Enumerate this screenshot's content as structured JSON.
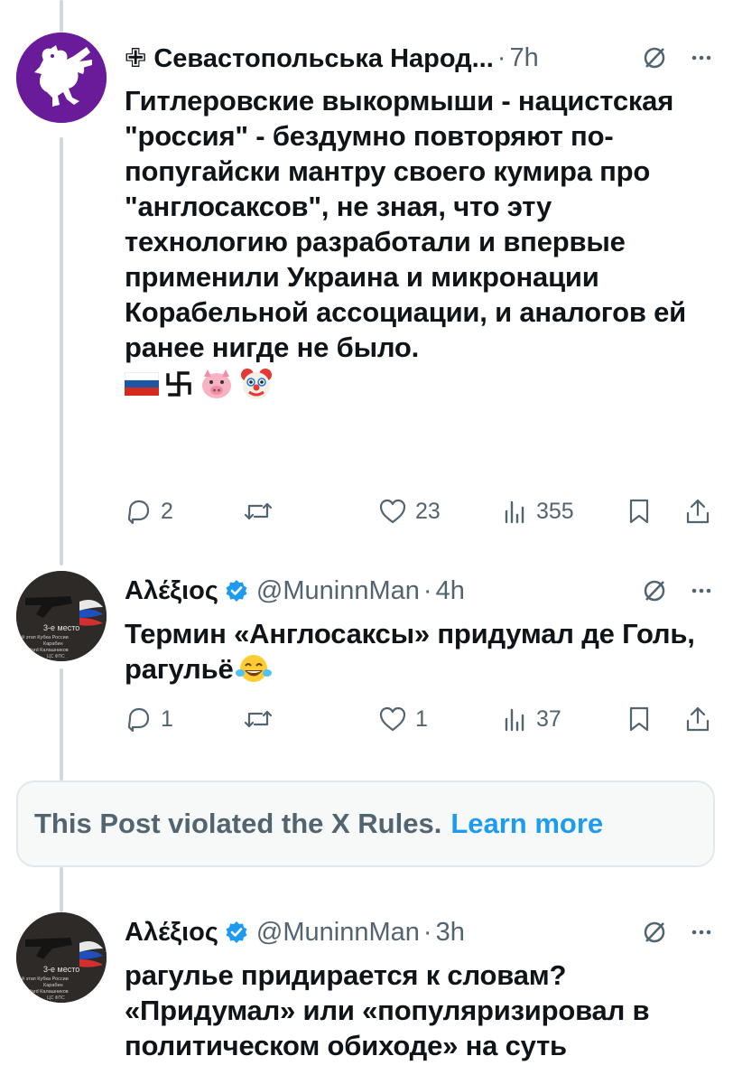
{
  "thread": [
    {
      "display_name": "✙ Севастопольська Народ...",
      "handle": "",
      "time": "7h",
      "text": "Гитлеровские выкормыши - нацистская \"россия\" - бездумно повторяют по-попугайски мантру своего кумира про \"англосаксов\", не зная, что эту технологию разработали и впервые применили Украина и микронации Корабельной ассоциации, и аналогов ей ранее нигде не было.",
      "emojis": [
        "russia-flag",
        "swastika",
        "pig-face",
        "clown-face"
      ],
      "stats": {
        "replies": "2",
        "reposts": "",
        "likes": "23",
        "views": "355"
      },
      "avatar_colors": {
        "bg": "#6a1b9a",
        "fg": "#ffffff"
      }
    },
    {
      "display_name": "Αλέξιος",
      "handle": "@MuninnMan",
      "time": "4h",
      "text": "Термин «Англосаксы» придумал  де Голь, рагульё",
      "emojis": [
        "tears-of-joy-face"
      ],
      "stats": {
        "replies": "1",
        "reposts": "",
        "likes": "1",
        "views": "37"
      },
      "avatar_text": [
        "3-е место",
        "й этап Кубка России",
        "Карабин",
        "tandard Калашников",
        "ЦС ФПС"
      ]
    },
    {
      "display_name": "Αλέξιος",
      "handle": "@MuninnMan",
      "time": "3h",
      "text": "рагулье придирается к словам? «Придумал» или «популяризировал в политическом обиходе» на суть",
      "avatar_text": [
        "3-е место",
        "й этап Кубка России",
        "Карабин",
        "tandard Калашников",
        "ЦС ФПС"
      ]
    }
  ],
  "violation_notice": {
    "message": "This Post violated the X Rules.",
    "link": "Learn more"
  },
  "colors": {
    "secondary_text": "#536471",
    "link": "#1d9bf0",
    "verified": "#1d9bf0",
    "thread_line": "#cfd9de"
  }
}
